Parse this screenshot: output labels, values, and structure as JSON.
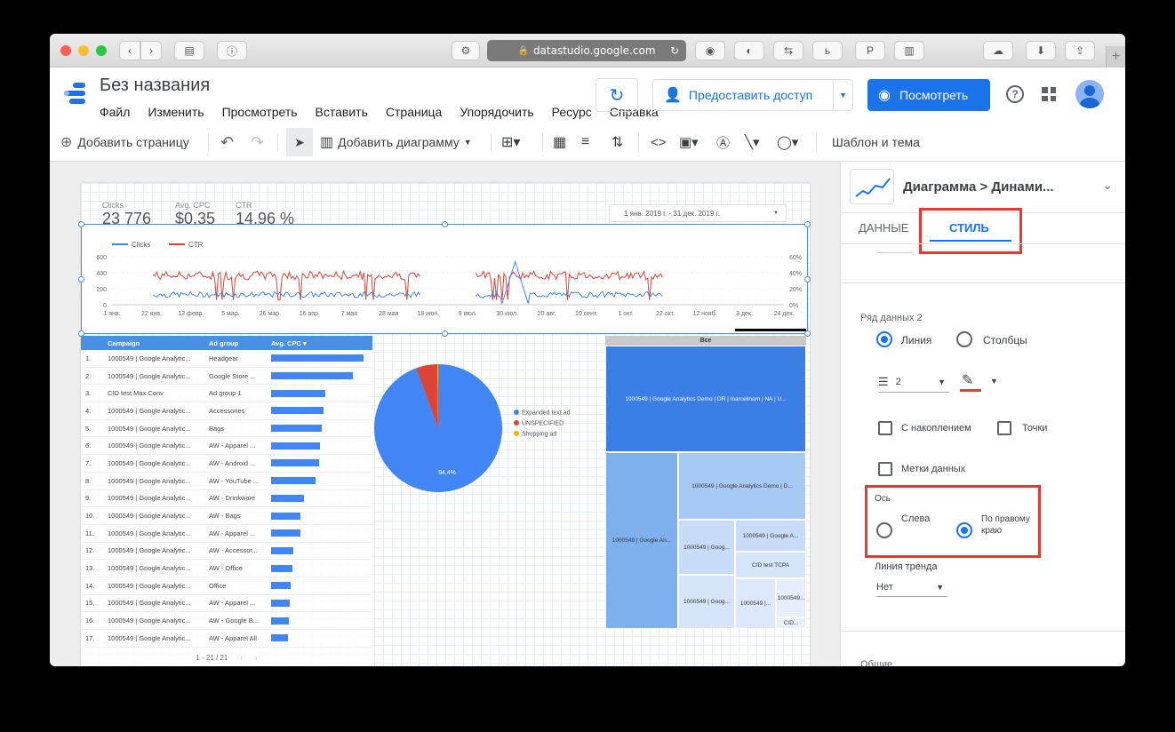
{
  "browser": {
    "url": "datastudio.google.com"
  },
  "app": {
    "title": "Без названия",
    "menu": [
      "Файл",
      "Изменить",
      "Просмотреть",
      "Вставить",
      "Страница",
      "Упорядочить",
      "Ресурс",
      "Справка"
    ],
    "share_label": "Предоставить доступ",
    "view_label": "Посмотреть"
  },
  "toolbar": {
    "add_page": "Добавить страницу",
    "add_chart": "Добавить диаграмму",
    "theme": "Шаблон и тема"
  },
  "report": {
    "scorecards": [
      {
        "label": "Clicks",
        "value": "23 776"
      },
      {
        "label": "Avg. CPC",
        "value": "$0,35"
      },
      {
        "label": "CTR",
        "value": "14,96 %"
      }
    ],
    "date_range": "1 янв. 2019 г. - 31 дек. 2019 г.",
    "colors": {
      "clicks": "#4285f4",
      "ctr": "#db4437",
      "accent": "#1a73e8",
      "highlight": "#e53935"
    },
    "table": {
      "headers": [
        "Campaign",
        "Ad group",
        "Avg. CPC ▾"
      ],
      "rows": [
        {
          "n": "1.",
          "campaign": "1000549 | Google Analytic...",
          "adgroup": "Headgear",
          "cpc": 1.0
        },
        {
          "n": "2.",
          "campaign": "1000549 | Google Analytic...",
          "adgroup": "Google Store ...",
          "cpc": 0.88
        },
        {
          "n": "3.",
          "campaign": "CID test Max Conv",
          "adgroup": "Ad group 1",
          "cpc": 0.59
        },
        {
          "n": "4.",
          "campaign": "1000549 | Google Analytic...",
          "adgroup": "Accessories",
          "cpc": 0.57
        },
        {
          "n": "5.",
          "campaign": "1000549 | Google Analytic...",
          "adgroup": "Bags",
          "cpc": 0.55
        },
        {
          "n": "6.",
          "campaign": "1000549 | Google Analytic...",
          "adgroup": "AW - Apparel ...",
          "cpc": 0.53
        },
        {
          "n": "7.",
          "campaign": "1000549 | Google Analytic...",
          "adgroup": "AW - Android ...",
          "cpc": 0.52
        },
        {
          "n": "8.",
          "campaign": "1000549 | Google Analytic...",
          "adgroup": "AW - YouTube ...",
          "cpc": 0.48
        },
        {
          "n": "9.",
          "campaign": "1000549 | Google Analytic...",
          "adgroup": "AW - Drinkware",
          "cpc": 0.36
        },
        {
          "n": "10.",
          "campaign": "1000549 | Google Analytic...",
          "adgroup": "AW - Bags",
          "cpc": 0.32
        },
        {
          "n": "11.",
          "campaign": "1000549 | Google Analytic...",
          "adgroup": "AW - Apparel ...",
          "cpc": 0.32
        },
        {
          "n": "12.",
          "campaign": "1000549 | Google Analytic...",
          "adgroup": "AW - Accessor...",
          "cpc": 0.24
        },
        {
          "n": "13.",
          "campaign": "1000549 | Google Analytic...",
          "adgroup": "AW - Office",
          "cpc": 0.23
        },
        {
          "n": "14.",
          "campaign": "1000549 | Google Analytic...",
          "adgroup": "Office",
          "cpc": 0.21
        },
        {
          "n": "15.",
          "campaign": "1000549 | Google Analytic...",
          "adgroup": "AW - Apparel ...",
          "cpc": 0.2
        },
        {
          "n": "16.",
          "campaign": "1000549 | Google Analytic...",
          "adgroup": "AW - Google B...",
          "cpc": 0.19
        },
        {
          "n": "17.",
          "campaign": "1000549 | Google Analytic...",
          "adgroup": "AW - Apparel All",
          "cpc": 0.18
        }
      ],
      "pagination": "1 - 21 / 21"
    },
    "pie": {
      "slices": [
        {
          "name": "Expanded text ad",
          "value": 94.4,
          "color": "#4285f4"
        },
        {
          "name": "UNSPECIFIED",
          "value": 5.4,
          "color": "#db4437"
        },
        {
          "name": "Shopping ad",
          "value": 0.2,
          "color": "#f4b400"
        }
      ],
      "label": "94,4%"
    },
    "treemap": {
      "header": "Все",
      "big_label": "1000549 | Google Analytics Demo | DR | marcelinom | NA | U...",
      "cells": [
        "1000549 | Google Analytics Demo | D...",
        "1000549 | Google An...",
        "1000549 | Goog...",
        "1000549 | Google A...",
        "CID test TCPA",
        "1000549 | Goog...",
        "1000549 |...",
        "1000549...",
        "CID..."
      ]
    },
    "timeseries": {
      "legend": [
        "Clicks",
        "CTR"
      ],
      "x_ticks": [
        "1 янв.",
        "22 янв.",
        "12 февр.",
        "5 мар.",
        "26 мар.",
        "16 апр.",
        "7 мая",
        "28 мая",
        "18 июн.",
        "9 июл.",
        "30 июл.",
        "20 авг.",
        "10 сент.",
        "1 окт.",
        "22 окт.",
        "12 нояб.",
        "3 дек.",
        "24 дек."
      ],
      "y_left": [
        "600",
        "400",
        "200",
        "0"
      ],
      "y_right": [
        "60%",
        "40%",
        "20%",
        "0%"
      ]
    }
  },
  "panel": {
    "header": "Диаграмма > Динами...",
    "tab_data": "ДАННЫЕ",
    "tab_style": "СТИЛЬ",
    "series_title": "Ряд данных 2",
    "opt_line": "Линия",
    "opt_bars": "Столбцы",
    "line_width": "2",
    "opt_cumulative": "С накоплением",
    "opt_points": "Точки",
    "opt_labels": "Метки данных",
    "axis_title": "Ось",
    "axis_left": "Слева",
    "axis_right": "По правому краю",
    "trend_title": "Линия тренда",
    "trend_value": "Нет",
    "general_title": "Общие"
  }
}
